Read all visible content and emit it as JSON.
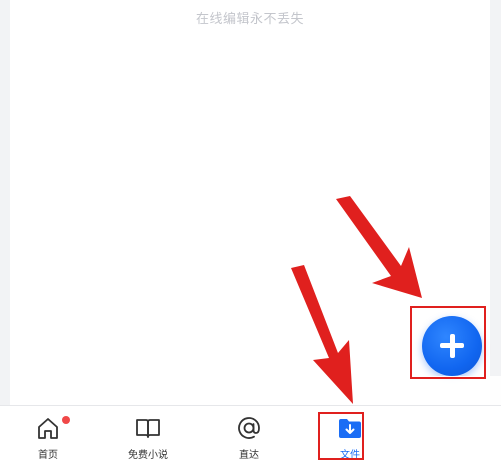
{
  "hint": {
    "text": "在线编辑永不丢失"
  },
  "fab": {
    "icon": "plus-icon",
    "accent_color": "#1166f0"
  },
  "tabbar": {
    "tabs": [
      {
        "label": "首页",
        "icon": "home-icon",
        "badge": "red-dot",
        "selected": false
      },
      {
        "label": "免费小说",
        "icon": "book-icon",
        "selected": false
      },
      {
        "label": "直达",
        "icon": "at-sign-icon",
        "selected": false
      },
      {
        "label": "文件",
        "icon": "folder-download-icon",
        "selected": true
      }
    ],
    "selected_color": "#1a6df5"
  },
  "annotations": {
    "arrow_color": "#e0201e",
    "highlight_color": "#e0201e"
  }
}
